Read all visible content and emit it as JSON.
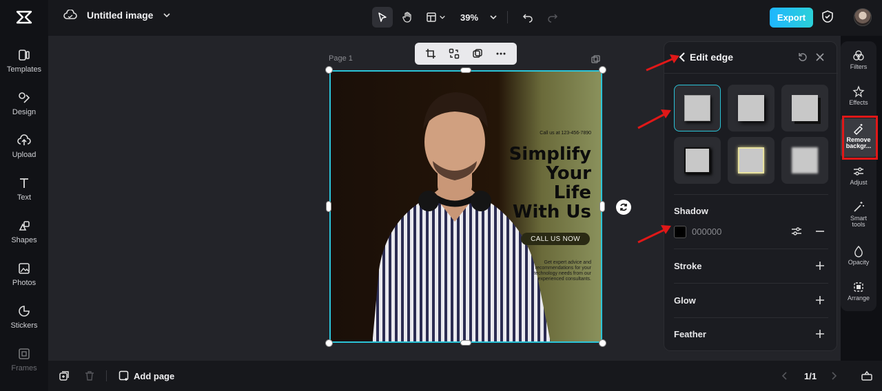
{
  "app": {
    "title": "Untitled image",
    "zoom": "39%",
    "export_label": "Export",
    "accent": "#2bc4d8"
  },
  "left_rail": {
    "items": [
      {
        "label": "Templates",
        "icon": "templates-icon"
      },
      {
        "label": "Design",
        "icon": "design-icon"
      },
      {
        "label": "Upload",
        "icon": "upload-icon"
      },
      {
        "label": "Text",
        "icon": "text-icon"
      },
      {
        "label": "Shapes",
        "icon": "shapes-icon"
      },
      {
        "label": "Photos",
        "icon": "photos-icon"
      },
      {
        "label": "Stickers",
        "icon": "stickers-icon"
      },
      {
        "label": "Frames",
        "icon": "frames-icon"
      }
    ]
  },
  "canvas": {
    "page_label": "Page 1",
    "artwork": {
      "phone": "Call us at 123-456-7890",
      "headline": [
        "Simplify",
        "Your",
        "Life",
        "With Us"
      ],
      "cta": "CALL US NOW",
      "body": "Get expert advice and recommendations for your technology needs from our experienced consultants."
    }
  },
  "panel": {
    "title": "Edit edge",
    "shadow": {
      "title": "Shadow",
      "color_value": "000000",
      "color": "#000000"
    },
    "stroke_title": "Stroke",
    "glow_title": "Glow",
    "feather_title": "Feather"
  },
  "right_rail": {
    "items": [
      {
        "label": "Filters"
      },
      {
        "label": "Effects"
      },
      {
        "label": "Remove backgr..."
      },
      {
        "label": "Adjust"
      },
      {
        "label": "Smart tools"
      },
      {
        "label": "Opacity"
      },
      {
        "label": "Arrange"
      }
    ]
  },
  "bottom": {
    "add_page": "Add page",
    "page_count": "1/1"
  }
}
